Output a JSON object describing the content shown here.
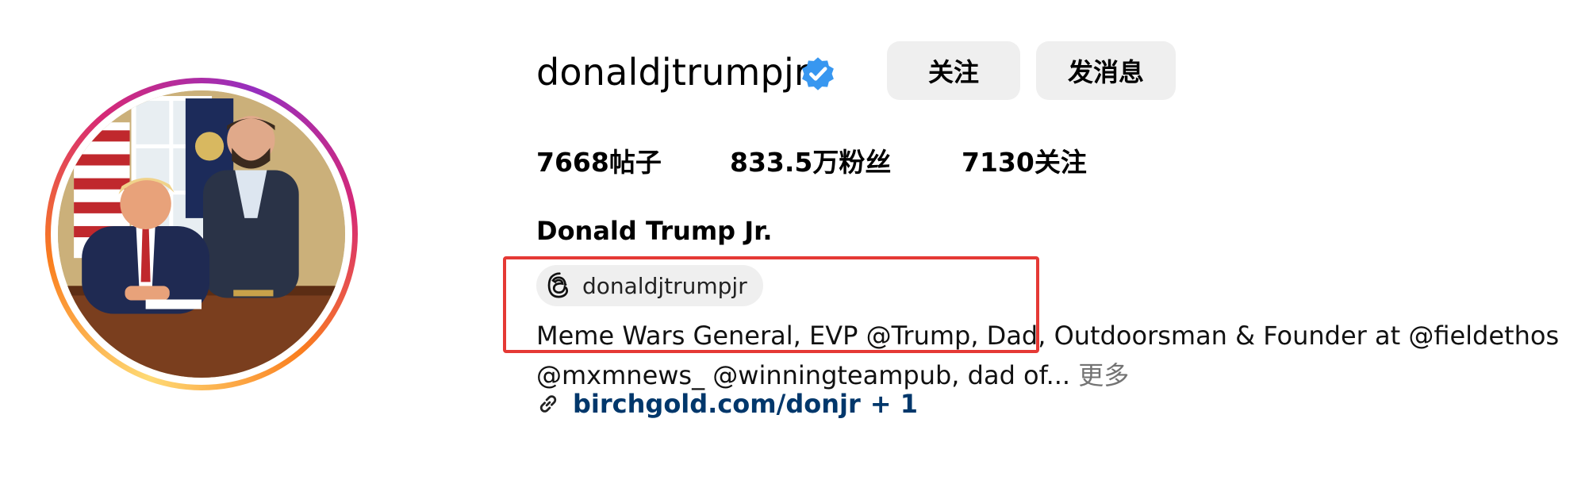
{
  "profile": {
    "username": "donaldjtrumpjr",
    "full_name": "Donald Trump Jr.",
    "verified": true,
    "buttons": {
      "follow": "关注",
      "message": "发消息"
    },
    "stats": {
      "posts": "7668帖子",
      "followers": "833.5万粉丝",
      "following": "7130关注"
    },
    "threads": {
      "handle": "donaldjtrumpjr",
      "icon": "threads-icon"
    },
    "bio": {
      "line1": "Meme Wars General, EVP @Trump, Dad, Outdoorsman & Founder at @fieldethos",
      "line2": "@mxmnews_ @winningteampub, dad of...",
      "more": "更多"
    },
    "link": {
      "url": "birchgold.com/donjr",
      "extra": "+ 1",
      "icon": "link-icon"
    }
  },
  "colors": {
    "verified": "#3897f0",
    "button_bg": "#efefef",
    "link": "#00376b",
    "highlight": "#e53935",
    "muted": "#737373"
  }
}
